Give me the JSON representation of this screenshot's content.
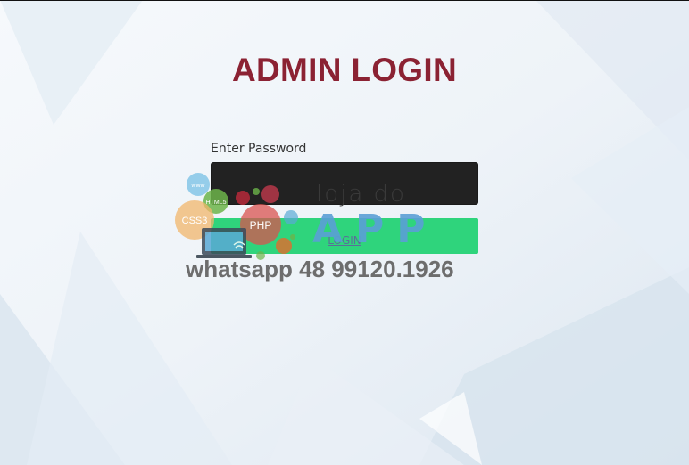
{
  "page": {
    "title": "ADMIN LOGIN"
  },
  "form": {
    "password_label": "Enter Password",
    "password_value": "",
    "login_label": "LOGIN"
  },
  "watermark": {
    "brand_line": "loja do",
    "brand_app": "APP",
    "contact": "whatsapp 48 99120.1926",
    "badges": [
      "www",
      "HTML5",
      "CSS3",
      "PHP"
    ]
  },
  "colors": {
    "title": "#8b2233",
    "input_bg": "#222222",
    "login_bg": "#2fd47c"
  }
}
